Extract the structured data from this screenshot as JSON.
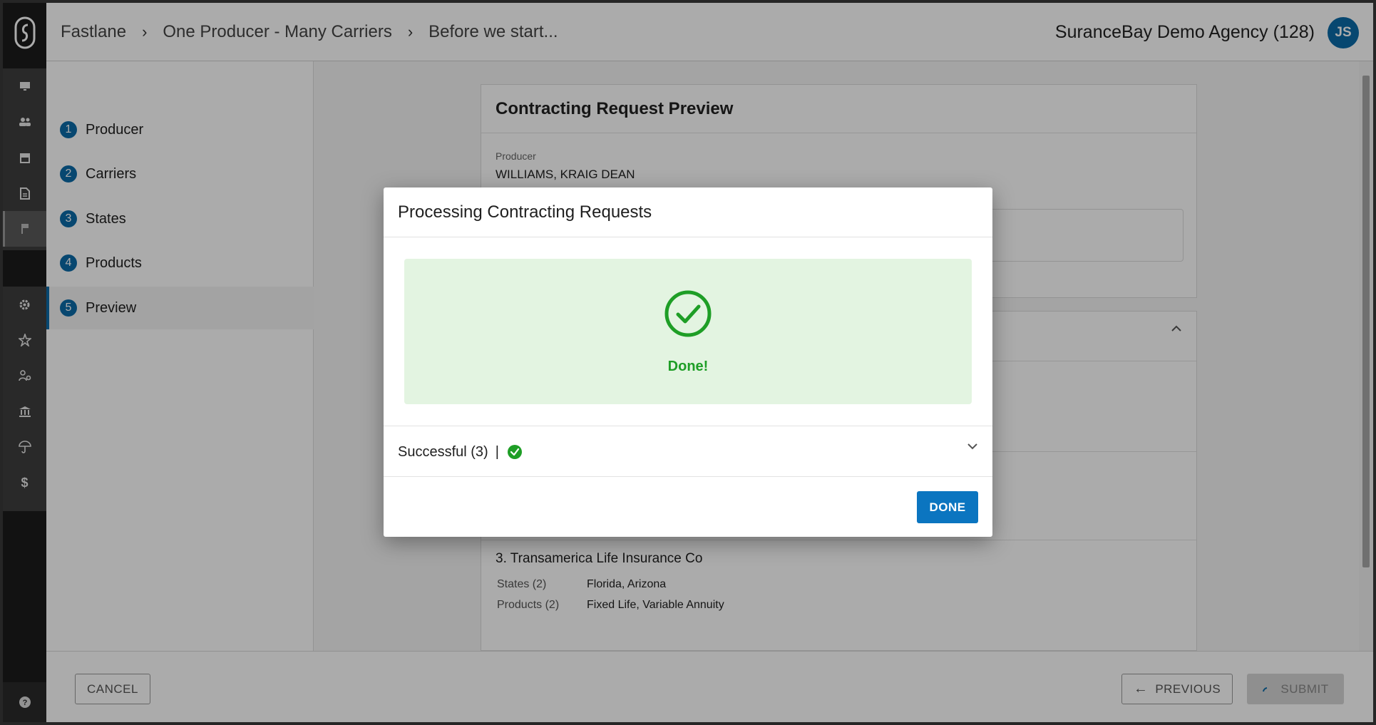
{
  "header": {
    "breadcrumbs": [
      "Fastlane",
      "One Producer - Many Carriers",
      "Before we start..."
    ],
    "agency": "SuranceBay Demo Agency (128)",
    "avatar_initials": "JS"
  },
  "steps": [
    {
      "num": "1",
      "label": "Producer"
    },
    {
      "num": "2",
      "label": "Carriers"
    },
    {
      "num": "3",
      "label": "States"
    },
    {
      "num": "4",
      "label": "Products"
    },
    {
      "num": "5",
      "label": "Preview"
    }
  ],
  "preview": {
    "title": "Contracting Request Preview",
    "producer_label": "Producer",
    "producer_value": "WILLIAMS, KRAIG DEAN",
    "carrier3": {
      "title": "3. Transamerica Life Insurance Co",
      "states_label": "States (2)",
      "states_value": "Florida, Arizona",
      "products_label": "Products (2)",
      "products_value": "Fixed Life, Variable Annuity"
    }
  },
  "footer": {
    "cancel": "CANCEL",
    "previous": "PREVIOUS",
    "submit": "SUBMIT"
  },
  "dialog": {
    "title": "Processing Contracting Requests",
    "status": "Done!",
    "successful": "Successful (3)",
    "pipe": "|",
    "done_button": "DONE"
  },
  "colors": {
    "accent": "#0b6aa8",
    "success": "#1e9e26",
    "success_bg": "#e3f4e1"
  },
  "icons": [
    "logo-icon",
    "monitor-icon",
    "people-icon",
    "store-icon",
    "document-icon",
    "flag-icon",
    "gear-icon",
    "star-badge-icon",
    "user-settings-icon",
    "bank-icon",
    "umbrella-icon",
    "dollar-icon",
    "help-icon",
    "check-circle-icon",
    "chevron-down-icon",
    "chevron-up-icon",
    "arrow-left-icon",
    "spinner-icon"
  ]
}
